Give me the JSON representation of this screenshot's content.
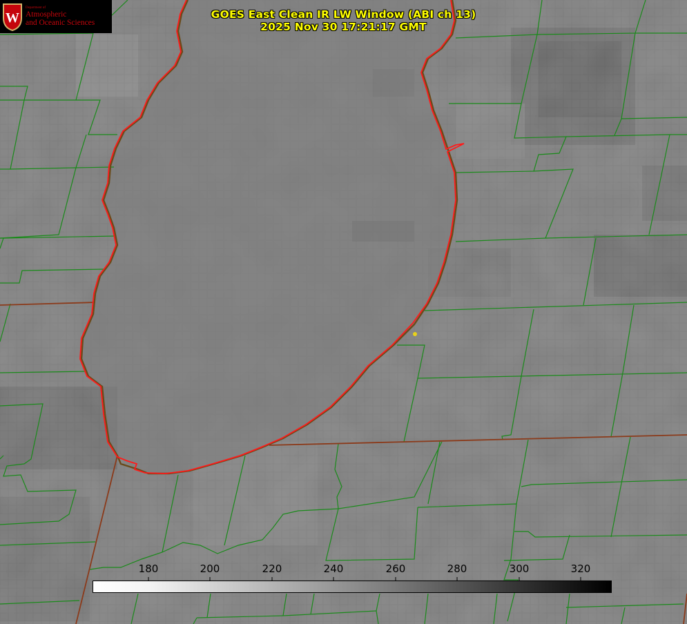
{
  "logo": {
    "department_line": "Department of",
    "name_line_1": "Atmospheric",
    "name_line_2": "and Oceanic Sciences",
    "seal_letter": "W"
  },
  "title": {
    "line1": "GOES East Clean IR LW Window (ABI ch 13)",
    "line2": "2025 Nov 30 17:21:17 GMT"
  },
  "colorbar": {
    "ticks": [
      "180",
      "200",
      "220",
      "240",
      "260",
      "280",
      "300",
      "320"
    ],
    "min_value": 162,
    "max_value": 330,
    "scale": "inverted grayscale (white = cold, black = warm)"
  },
  "colors": {
    "title_text": "#ffff00",
    "coastline": "#ff1a1a",
    "county_borders": "#1a8a1a",
    "state_borders": "#8b3a1a",
    "station_marker": "#e8d21a"
  }
}
